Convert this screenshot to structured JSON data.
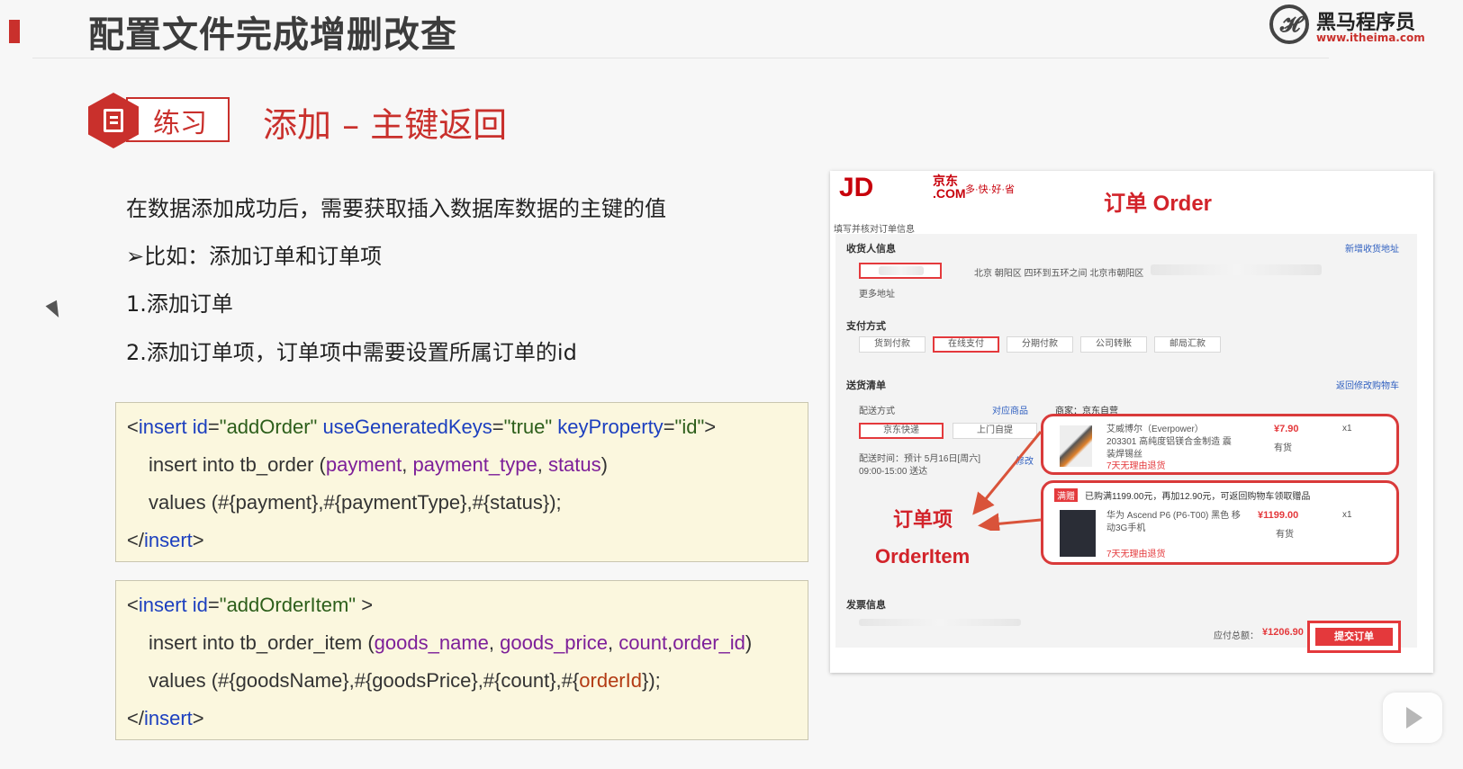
{
  "header": {
    "title": "配置文件完成增删改查",
    "logo_name": "黑马程序员",
    "logo_url": "www.itheima.com"
  },
  "practice": {
    "badge_label": "练习",
    "title": "添加 – 主键返回"
  },
  "bullets": [
    "在数据添加成功后，需要获取插入数据库数据的主键的值",
    "➢比如：添加订单和订单项",
    "1.添加订单",
    "2.添加订单项，订单项中需要设置所属订单的id"
  ],
  "code1": {
    "l1_open": "<",
    "l1_tag": "insert",
    "l1_attr1": " id",
    "l1_eq1": "=",
    "l1_val1": "\"addOrder\"",
    "l1_attr2": " useGeneratedKeys",
    "l1_eq2": "=",
    "l1_val2": "\"true\"",
    "l1_attr3": " keyProperty",
    "l1_eq3": "=",
    "l1_val3": "\"id\"",
    "l1_close": ">",
    "l2_pre": "insert into tb_order (",
    "l2_f1": "payment",
    "l2_sep1": ", ",
    "l2_f2": "payment_type",
    "l2_sep2": ", ",
    "l2_f3": "status",
    "l2_post": ")",
    "l3": "values (#{payment},#{paymentType},#{status});",
    "l4_open": "</",
    "l4_tag": "insert",
    "l4_close": ">"
  },
  "code2": {
    "l1_open": "<",
    "l1_tag": "insert",
    "l1_attr1": " id",
    "l1_eq1": "=",
    "l1_val1": "\"addOrderItem\"",
    "l1_close": " >",
    "l2_pre": "insert into tb_order_item (",
    "l2_f1": "goods_name",
    "l2_sep1": ", ",
    "l2_f2": "goods_price",
    "l2_sep2": ", ",
    "l2_f3": "count",
    "l2_sep3": ",",
    "l2_f4": "order_id",
    "l2_post": ")",
    "l3_pre": "values (#{goodsName},#{goodsPrice},#{count},#{",
    "l3_hl": "orderId",
    "l3_post": "});",
    "l4_open": "</",
    "l4_tag": "insert",
    "l4_close": ">"
  },
  "jd": {
    "logo": "JD",
    "logo_sub1": "京东",
    "logo_sub2": ".COM",
    "slogan": "多·快·好·省",
    "order_heading": "订单 Order",
    "fill_check": "填写并核对订单信息",
    "receiver_label": "收货人信息",
    "new_address": "新增收货地址",
    "address_text": "北京 朝阳区 四环到五环之间 北京市朝阳区",
    "more_address": "更多地址",
    "payment_label": "支付方式",
    "payment_options": [
      "货到付款",
      "在线支付",
      "分期付款",
      "公司转账",
      "邮局汇款"
    ],
    "shipping_list": "送货清单",
    "back_to_cart": "返回修改购物车",
    "delivery_method": "配送方式",
    "matched_goods": "对应商品",
    "seller": "商家：京东自营",
    "jd_express": "京东快递",
    "self_pickup": "上门自提",
    "delivery_time": "配送时间：预计 5月16日[周六] 09:00-15:00 送达",
    "modify": "修改",
    "item1_name": "艾威博尔（Everpower）203301 高纯度铝镁合金制造 震装焊锡丝",
    "item1_price": "¥7.90",
    "item1_qty": "x1",
    "item1_stock": "有货",
    "return_policy": "7天无理由退货",
    "promo_tag": "满赠",
    "promo_text": "已购满1199.00元，再加12.90元，可返回购物车领取赠品",
    "item2_name": "华为 Ascend P6 (P6-T00) 黑色 移动3G手机",
    "item2_price": "¥1199.00",
    "item2_qty": "x1",
    "item2_stock": "有货",
    "order_item_cn": "订单项",
    "order_item_en": "OrderItem",
    "invoice_label": "发票信息",
    "total_label": "应付总额：",
    "total_value": "¥1206.90",
    "submit": "提交订单"
  }
}
